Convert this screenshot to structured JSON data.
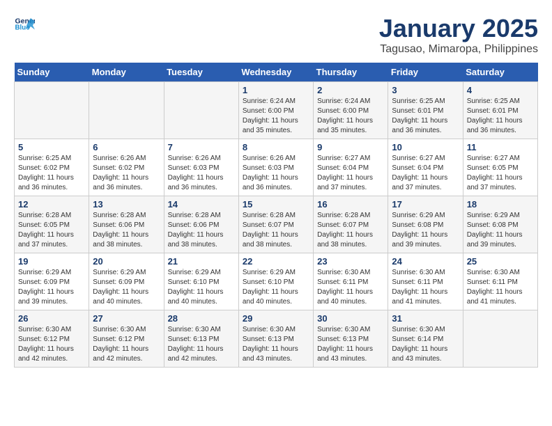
{
  "header": {
    "logo_line1": "General",
    "logo_line2": "Blue",
    "month": "January 2025",
    "location": "Tagusao, Mimaropa, Philippines"
  },
  "days_of_week": [
    "Sunday",
    "Monday",
    "Tuesday",
    "Wednesday",
    "Thursday",
    "Friday",
    "Saturday"
  ],
  "weeks": [
    [
      {
        "day": "",
        "info": ""
      },
      {
        "day": "",
        "info": ""
      },
      {
        "day": "",
        "info": ""
      },
      {
        "day": "1",
        "info": "Sunrise: 6:24 AM\nSunset: 6:00 PM\nDaylight: 11 hours\nand 35 minutes."
      },
      {
        "day": "2",
        "info": "Sunrise: 6:24 AM\nSunset: 6:00 PM\nDaylight: 11 hours\nand 35 minutes."
      },
      {
        "day": "3",
        "info": "Sunrise: 6:25 AM\nSunset: 6:01 PM\nDaylight: 11 hours\nand 36 minutes."
      },
      {
        "day": "4",
        "info": "Sunrise: 6:25 AM\nSunset: 6:01 PM\nDaylight: 11 hours\nand 36 minutes."
      }
    ],
    [
      {
        "day": "5",
        "info": "Sunrise: 6:25 AM\nSunset: 6:02 PM\nDaylight: 11 hours\nand 36 minutes."
      },
      {
        "day": "6",
        "info": "Sunrise: 6:26 AM\nSunset: 6:02 PM\nDaylight: 11 hours\nand 36 minutes."
      },
      {
        "day": "7",
        "info": "Sunrise: 6:26 AM\nSunset: 6:03 PM\nDaylight: 11 hours\nand 36 minutes."
      },
      {
        "day": "8",
        "info": "Sunrise: 6:26 AM\nSunset: 6:03 PM\nDaylight: 11 hours\nand 36 minutes."
      },
      {
        "day": "9",
        "info": "Sunrise: 6:27 AM\nSunset: 6:04 PM\nDaylight: 11 hours\nand 37 minutes."
      },
      {
        "day": "10",
        "info": "Sunrise: 6:27 AM\nSunset: 6:04 PM\nDaylight: 11 hours\nand 37 minutes."
      },
      {
        "day": "11",
        "info": "Sunrise: 6:27 AM\nSunset: 6:05 PM\nDaylight: 11 hours\nand 37 minutes."
      }
    ],
    [
      {
        "day": "12",
        "info": "Sunrise: 6:28 AM\nSunset: 6:05 PM\nDaylight: 11 hours\nand 37 minutes."
      },
      {
        "day": "13",
        "info": "Sunrise: 6:28 AM\nSunset: 6:06 PM\nDaylight: 11 hours\nand 38 minutes."
      },
      {
        "day": "14",
        "info": "Sunrise: 6:28 AM\nSunset: 6:06 PM\nDaylight: 11 hours\nand 38 minutes."
      },
      {
        "day": "15",
        "info": "Sunrise: 6:28 AM\nSunset: 6:07 PM\nDaylight: 11 hours\nand 38 minutes."
      },
      {
        "day": "16",
        "info": "Sunrise: 6:28 AM\nSunset: 6:07 PM\nDaylight: 11 hours\nand 38 minutes."
      },
      {
        "day": "17",
        "info": "Sunrise: 6:29 AM\nSunset: 6:08 PM\nDaylight: 11 hours\nand 39 minutes."
      },
      {
        "day": "18",
        "info": "Sunrise: 6:29 AM\nSunset: 6:08 PM\nDaylight: 11 hours\nand 39 minutes."
      }
    ],
    [
      {
        "day": "19",
        "info": "Sunrise: 6:29 AM\nSunset: 6:09 PM\nDaylight: 11 hours\nand 39 minutes."
      },
      {
        "day": "20",
        "info": "Sunrise: 6:29 AM\nSunset: 6:09 PM\nDaylight: 11 hours\nand 40 minutes."
      },
      {
        "day": "21",
        "info": "Sunrise: 6:29 AM\nSunset: 6:10 PM\nDaylight: 11 hours\nand 40 minutes."
      },
      {
        "day": "22",
        "info": "Sunrise: 6:29 AM\nSunset: 6:10 PM\nDaylight: 11 hours\nand 40 minutes."
      },
      {
        "day": "23",
        "info": "Sunrise: 6:30 AM\nSunset: 6:11 PM\nDaylight: 11 hours\nand 40 minutes."
      },
      {
        "day": "24",
        "info": "Sunrise: 6:30 AM\nSunset: 6:11 PM\nDaylight: 11 hours\nand 41 minutes."
      },
      {
        "day": "25",
        "info": "Sunrise: 6:30 AM\nSunset: 6:11 PM\nDaylight: 11 hours\nand 41 minutes."
      }
    ],
    [
      {
        "day": "26",
        "info": "Sunrise: 6:30 AM\nSunset: 6:12 PM\nDaylight: 11 hours\nand 42 minutes."
      },
      {
        "day": "27",
        "info": "Sunrise: 6:30 AM\nSunset: 6:12 PM\nDaylight: 11 hours\nand 42 minutes."
      },
      {
        "day": "28",
        "info": "Sunrise: 6:30 AM\nSunset: 6:13 PM\nDaylight: 11 hours\nand 42 minutes."
      },
      {
        "day": "29",
        "info": "Sunrise: 6:30 AM\nSunset: 6:13 PM\nDaylight: 11 hours\nand 43 minutes."
      },
      {
        "day": "30",
        "info": "Sunrise: 6:30 AM\nSunset: 6:13 PM\nDaylight: 11 hours\nand 43 minutes."
      },
      {
        "day": "31",
        "info": "Sunrise: 6:30 AM\nSunset: 6:14 PM\nDaylight: 11 hours\nand 43 minutes."
      },
      {
        "day": "",
        "info": ""
      }
    ]
  ]
}
